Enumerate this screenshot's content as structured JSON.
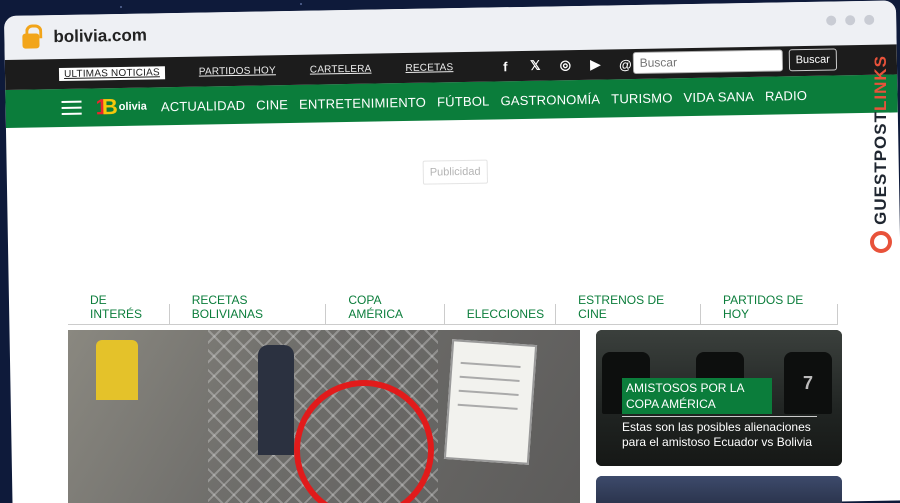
{
  "browser": {
    "url": "bolivia.com"
  },
  "topbar": {
    "links": [
      {
        "label": "ULTIMAS NOTICIAS"
      },
      {
        "label": "PARTIDOS HOY"
      },
      {
        "label": "CARTELERA"
      },
      {
        "label": "RECETAS"
      }
    ],
    "social": [
      {
        "icon": "facebook-icon",
        "glyph": "f"
      },
      {
        "icon": "x-icon",
        "glyph": "𝕏"
      },
      {
        "icon": "instagram-icon",
        "glyph": "◎"
      },
      {
        "icon": "youtube-icon",
        "glyph": "▶"
      },
      {
        "icon": "threads-icon",
        "glyph": "@"
      }
    ],
    "search": {
      "placeholder": "Buscar",
      "button": "Buscar"
    }
  },
  "navbar": {
    "logo": {
      "num": "1",
      "letter": "B",
      "text": "olivia"
    },
    "items": [
      "ACTUALIDAD",
      "CINE",
      "ENTRETENIMIENTO",
      "FÚTBOL",
      "GASTRONOMÍA",
      "TURISMO",
      "VIDA SANA",
      "RADIO"
    ]
  },
  "ad": {
    "label": "Publicidad"
  },
  "tags": [
    "DE INTERÉS",
    "RECETAS BOLIVIANAS",
    "COPA AMÉRICA",
    "ELECCIONES",
    "ESTRENOS DE CINE",
    "PARTIDOS DE HOY"
  ],
  "card": {
    "category": "AMISTOSOS POR LA COPA AMÉRICA",
    "title": "Estas son las posibles alienaciones para el amistoso Ecuador vs Bolivia",
    "jerseys": [
      "",
      "",
      "7"
    ]
  },
  "watermark": {
    "part1": "GUESTPOST",
    "part2": "LINKS"
  },
  "colors": {
    "green": "#0b7d3b",
    "topbar": "#1c1c1c",
    "accent": "#e8523a"
  }
}
